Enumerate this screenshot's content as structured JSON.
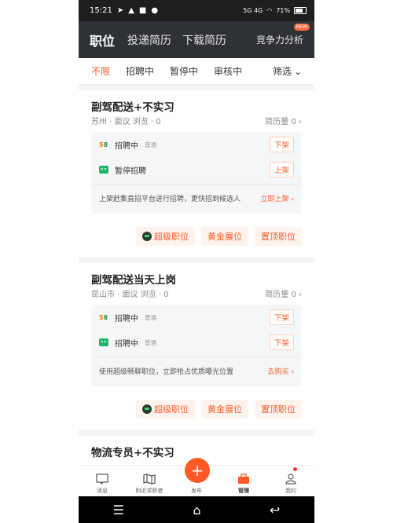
{
  "status": {
    "time": "15:21",
    "battery": "71%",
    "net": "5G 4G"
  },
  "topnav": {
    "active": "职位",
    "tab2": "投递简历",
    "tab3": "下载简历",
    "right": "竞争力分析",
    "badge": "NEW"
  },
  "filters": {
    "items": [
      "不限",
      "招聘中",
      "暂停中",
      "审核中"
    ],
    "right": "筛选"
  },
  "cards": [
    {
      "title": "副驾配送+不实习",
      "meta": "苏州 · 面议   浏览 · 0",
      "resume": "简历量 0",
      "rows": [
        {
          "status": "招聘中",
          "tag": "普通",
          "btn": "下架"
        },
        {
          "status": "暂停招聘",
          "tag": "",
          "btn": "上架"
        }
      ],
      "promo": "上架赶集直招平台进行招聘，更快招到候选人",
      "promo_link": "立即上架",
      "actions": [
        "超级职位",
        "黄金展位",
        "置顶职位"
      ]
    },
    {
      "title": "副驾配送当天上岗",
      "meta": "昆山市 · 面议   浏览 · 0",
      "resume": "简历量 0",
      "rows": [
        {
          "status": "招聘中",
          "tag": "普通",
          "btn": "下架"
        },
        {
          "status": "招聘中",
          "tag": "普通",
          "btn": "下架"
        }
      ],
      "promo": "使用超级畅聊职位，立即抢占优质曝光位置",
      "promo_link": "去购买",
      "actions": [
        "超级职位",
        "黄金展位",
        "置顶职位"
      ]
    },
    {
      "title": "物流专员+不实习"
    }
  ],
  "tabs": [
    "消息",
    "附近求职者",
    "发布",
    "管理",
    "我的"
  ]
}
